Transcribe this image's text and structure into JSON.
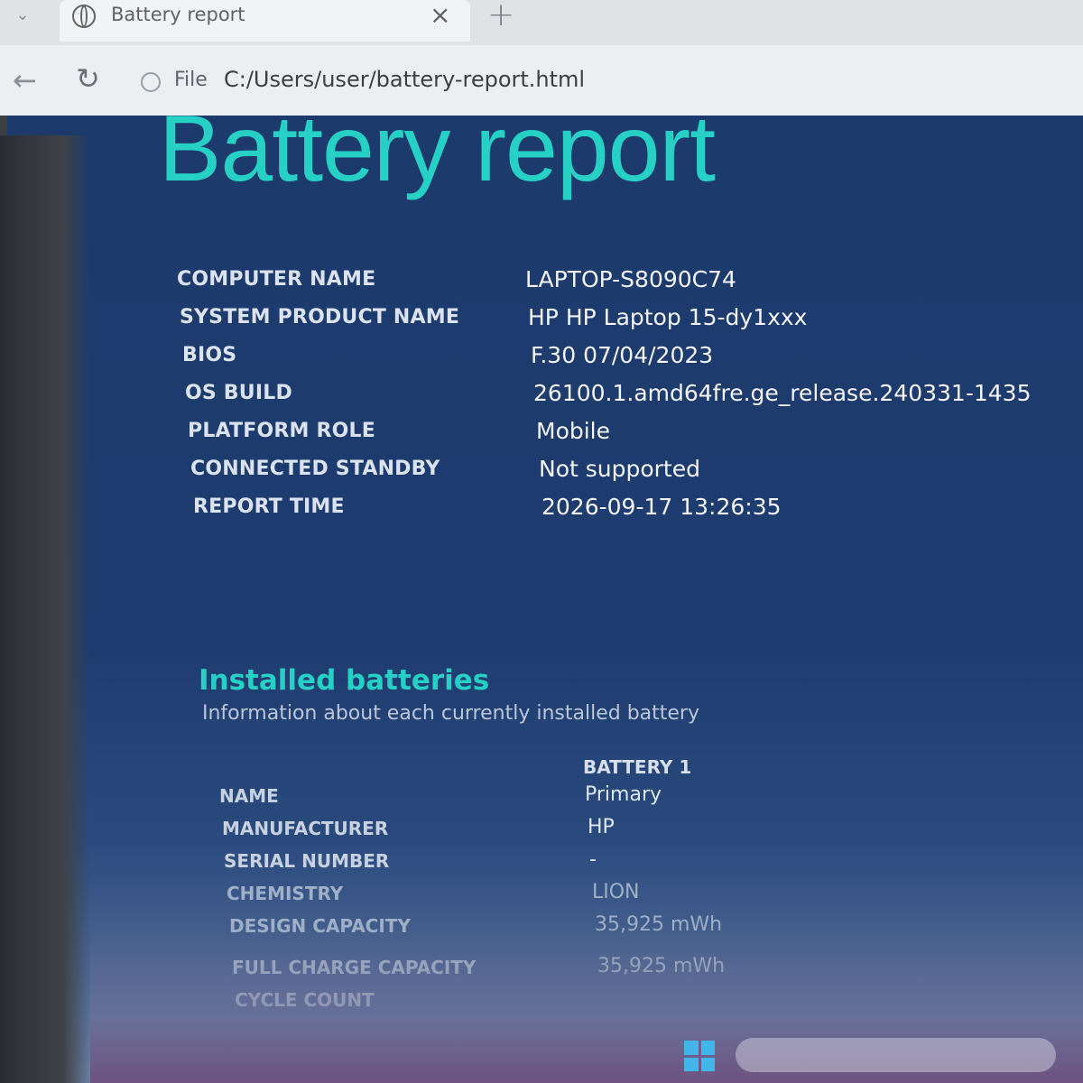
{
  "browser": {
    "tab_title": "Battery report",
    "close_glyph": "×",
    "new_tab_glyph": "+",
    "back_glyph": "←",
    "reload_glyph": "↻",
    "dropdown_glyph": "⌄",
    "url_scheme": "File",
    "url": "C:/Users/user/battery-report.html"
  },
  "report": {
    "title": "Battery report",
    "system_info": [
      {
        "label": "COMPUTER NAME",
        "value": "LAPTOP-S8090C74"
      },
      {
        "label": "SYSTEM PRODUCT NAME",
        "value": "HP HP Laptop 15-dy1xxx"
      },
      {
        "label": "BIOS",
        "value": "F.30 07/04/2023"
      },
      {
        "label": "OS BUILD",
        "value": "26100.1.amd64fre.ge_release.240331-1435"
      },
      {
        "label": "PLATFORM ROLE",
        "value": "Mobile"
      },
      {
        "label": "CONNECTED STANDBY",
        "value": "Not supported"
      },
      {
        "label": "REPORT TIME",
        "value": "2026-09-17  13:26:35"
      }
    ],
    "installed_batteries": {
      "title": "Installed batteries",
      "subtitle": "Information about each currently installed battery",
      "column_header": "BATTERY 1",
      "rows": [
        {
          "label": "NAME",
          "value": "Primary"
        },
        {
          "label": "MANUFACTURER",
          "value": "HP"
        },
        {
          "label": "SERIAL NUMBER",
          "value": "-"
        },
        {
          "label": "CHEMISTRY",
          "value": "LION"
        },
        {
          "label": "DESIGN CAPACITY",
          "value": "35,925 mWh"
        },
        {
          "label": "FULL CHARGE CAPACITY",
          "value": "35,925 mWh"
        },
        {
          "label": "CYCLE COUNT",
          "value": ""
        }
      ]
    }
  },
  "colors": {
    "accent": "#26d0c4",
    "page_background": "#1e3c70"
  },
  "icons": {
    "tab_favicon": "globe-icon",
    "info": "info-circle-icon"
  }
}
